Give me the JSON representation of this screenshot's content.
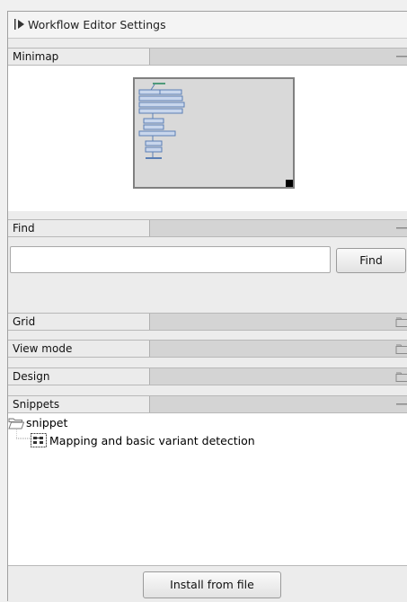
{
  "panel": {
    "title": "Workflow Editor Settings"
  },
  "sections": {
    "minimap": {
      "label": "Minimap",
      "state": "expanded"
    },
    "find": {
      "label": "Find",
      "state": "expanded",
      "input_value": "",
      "button_label": "Find"
    },
    "grid": {
      "label": "Grid",
      "state": "collapsed"
    },
    "view_mode": {
      "label": "View mode",
      "state": "collapsed"
    },
    "design": {
      "label": "Design",
      "state": "collapsed"
    },
    "snippets": {
      "label": "Snippets",
      "state": "expanded",
      "tree": {
        "folder": "snippet",
        "items": [
          "Mapping and basic variant detection"
        ]
      },
      "install_button": "Install from file"
    }
  },
  "colors": {
    "header_bg": "#d4d4d4",
    "minimap_bg": "#d9d9d9",
    "node_blue": "#5b7fb5",
    "node_green": "#4f9a7a"
  }
}
